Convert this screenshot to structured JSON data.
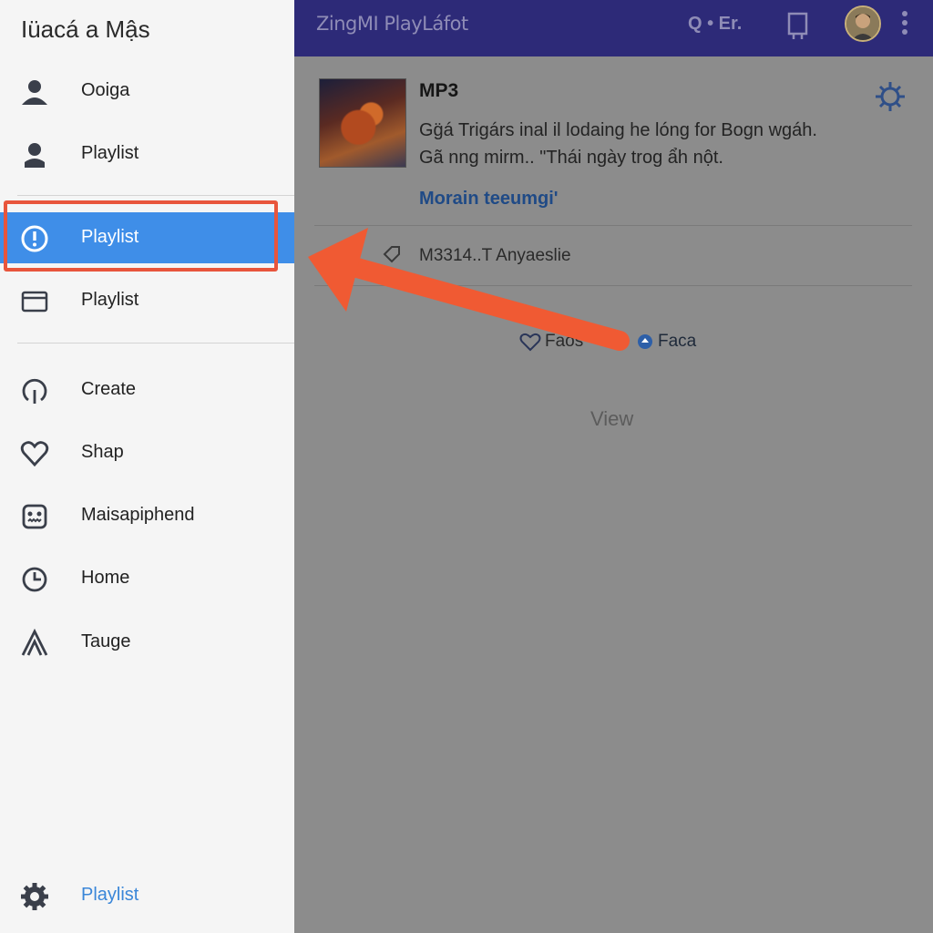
{
  "topbar": {
    "title": "ZingMI PlayLáfot",
    "search_combo": "Q • Er.",
    "icons": [
      "search-icon",
      "bookmark-icon",
      "avatar",
      "more-vert-icon"
    ]
  },
  "card": {
    "title": "MP3",
    "description_line1": "Gg̈á Trigárs inal il lodaing he lóng for Bogn wgáh.",
    "description_line2": "Gã nng mirm.. \"Thái ngày trog ẩh nột.",
    "link": "Morain teeumgi'",
    "meta": "M3314..T Anyaeslie",
    "fav_label": "Faos",
    "face_label": "Faca",
    "view_label": "View"
  },
  "drawer": {
    "header": "Iüacá a Mậs",
    "items": [
      {
        "label": "Ooiga",
        "icon": "person-icon"
      },
      {
        "label": "Playlist",
        "icon": "person-outline-icon"
      },
      {
        "label": "Playlist",
        "icon": "info-icon",
        "active": true
      },
      {
        "label": "Playlist",
        "icon": "window-icon"
      },
      {
        "label": "Create",
        "icon": "create-icon"
      },
      {
        "label": "Shap",
        "icon": "heart-icon"
      },
      {
        "label": "Maisapiphend",
        "icon": "robot-icon"
      },
      {
        "label": "Home",
        "icon": "clock-icon"
      },
      {
        "label": "Tauge",
        "icon": "font-icon"
      }
    ],
    "bottom_item": {
      "label": "Playlist",
      "icon": "gear-icon"
    }
  },
  "colors": {
    "topbar": "#2d2a78",
    "active_item": "#3f8ee8",
    "highlight": "#e8553c",
    "arrow": "#f05a33",
    "link": "#1f4a86"
  }
}
